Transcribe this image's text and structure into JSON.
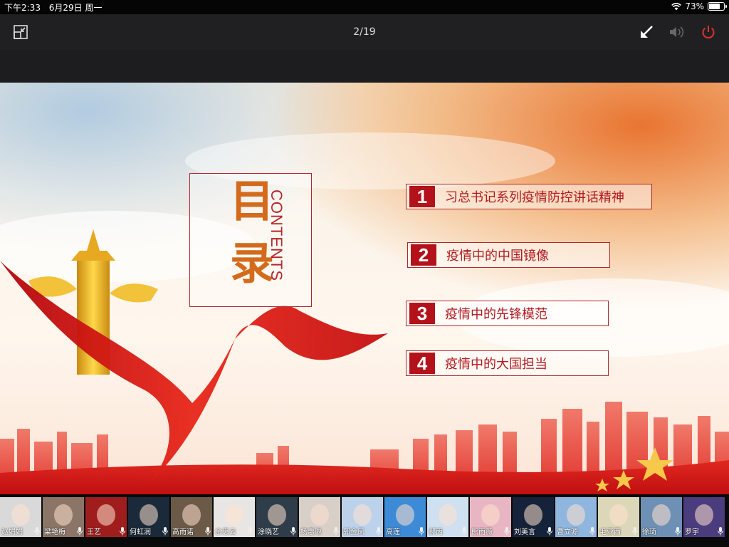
{
  "status_bar": {
    "time": "下午2:33",
    "date": "6月29日 周一",
    "battery_percent": "73%",
    "battery_level": 0.73
  },
  "toolbar": {
    "page_indicator": "2/19"
  },
  "slide": {
    "title_char1": "目",
    "title_char2": "录",
    "title_en": "CONTENTS",
    "toc": [
      {
        "num": "1",
        "text": "习总书记系列疫情防控讲话精神"
      },
      {
        "num": "2",
        "text": "疫情中的中国镜像"
      },
      {
        "num": "3",
        "text": "疫情中的先锋模范"
      },
      {
        "num": "4",
        "text": "疫情中的大国担当"
      }
    ]
  },
  "participants": [
    {
      "name": "赵娟娟",
      "bg": "#d9d9d9"
    },
    {
      "name": "梁艳梅",
      "bg": "#8a7566"
    },
    {
      "name": "王艺",
      "bg": "#a01d1d"
    },
    {
      "name": "何虹润",
      "bg": "#1a2a3a"
    },
    {
      "name": "高雨诺",
      "bg": "#6b5a48"
    },
    {
      "name": "余思云",
      "bg": "#e8e6e4"
    },
    {
      "name": "涂晓艺",
      "bg": "#2f3d4a"
    },
    {
      "name": "杨惠琳",
      "bg": "#d8cfc8"
    },
    {
      "name": "郭金凤",
      "bg": "#bcd2ea"
    },
    {
      "name": "高莲",
      "bg": "#3d8ad6"
    },
    {
      "name": "郝丙",
      "bg": "#cfe0f0"
    },
    {
      "name": "熊雨薇",
      "bg": "#e8b6c2"
    },
    {
      "name": "刘美言",
      "bg": "#15233a"
    },
    {
      "name": "曹立源",
      "bg": "#8fb6df"
    },
    {
      "name": "毛亚西",
      "bg": "#dcd7b8"
    },
    {
      "name": "徐琦",
      "bg": "#6e90b5"
    },
    {
      "name": "罗宇",
      "bg": "#4b3c7e"
    }
  ]
}
